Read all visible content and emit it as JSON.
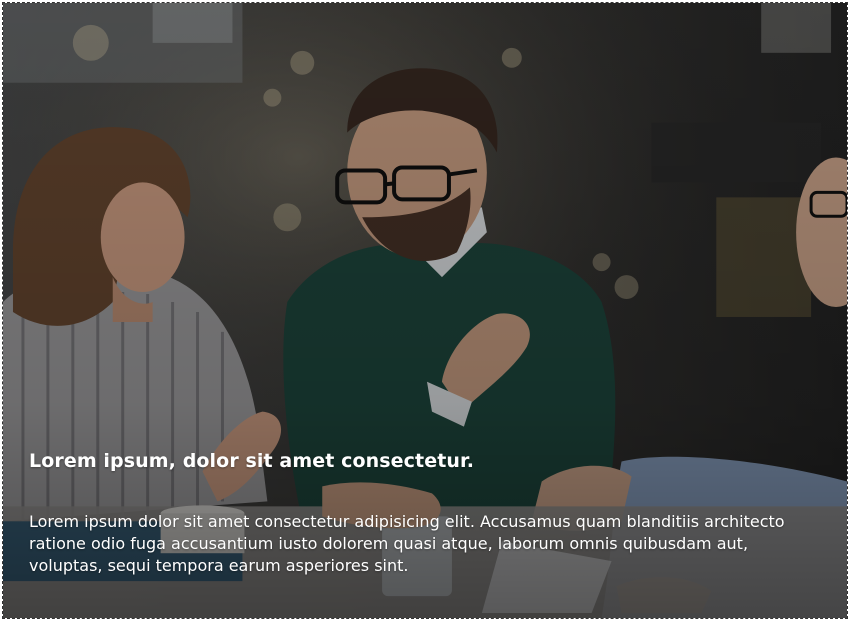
{
  "hero": {
    "image_subject": "three colleagues talking at a table in a cafe-style office",
    "overlay_color": "#000000",
    "title": "Lorem ipsum, dolor sit amet consectetur.",
    "body": "Lorem ipsum dolor sit amet consectetur adipisicing elit. Accusamus quam blanditiis architecto ratione odio fuga accusantium iusto dolorem quasi atque, laborum omnis quibusdam aut, voluptas, sequi tempora earum asperiores sint."
  }
}
